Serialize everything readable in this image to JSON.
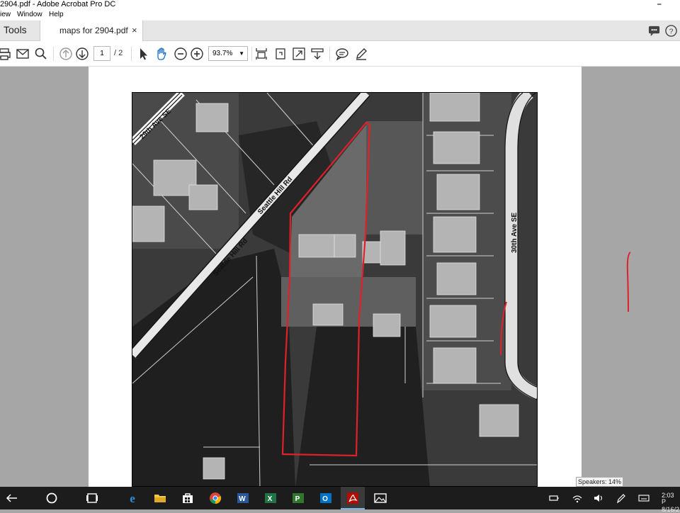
{
  "window": {
    "title": "2904.pdf - Adobe Acrobat Pro DC"
  },
  "menu": {
    "items": [
      "iew",
      "Window",
      "Help"
    ]
  },
  "tabs": {
    "tools_label": "Tools",
    "doc_label": "maps for 2904.pdf",
    "close_glyph": "×"
  },
  "toolbar": {
    "current_page": "1",
    "total_pages": "/ 2",
    "zoom": "93.7%",
    "icons": [
      "print-icon",
      "email-icon",
      "search-icon",
      "page-up-icon",
      "page-down-icon",
      "select-arrow-icon",
      "hand-icon",
      "zoom-out-icon",
      "zoom-in-icon",
      "fit-page-icon",
      "rotate-icon",
      "full-screen-icon",
      "scroll-mode-icon",
      "comment-icon",
      "pen-icon"
    ]
  },
  "map": {
    "labels": {
      "road_29th": "29th Ave SE",
      "road_seattle_hill_1": "Seattle Hill Rd",
      "road_seattle_hill_2": "Seattle Hill Rd",
      "road_30th": "30th Ave SE"
    },
    "annotation_color": "#e0202a"
  },
  "status": {
    "speakers": "Speakers: 14%"
  },
  "taskbar": {
    "apps": [
      "back-icon",
      "start-icon",
      "task-view-icon",
      "edge-icon",
      "file-explorer-icon",
      "store-icon",
      "chrome-icon",
      "word-icon",
      "excel-icon",
      "project-icon",
      "outlook-icon",
      "acrobat-icon",
      "photos-icon"
    ],
    "clock_time": "2:03 P",
    "clock_date": "8/16/2"
  }
}
